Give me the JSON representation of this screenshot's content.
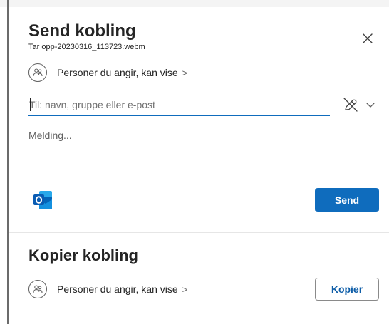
{
  "send_link": {
    "title": "Send kobling",
    "filename": "Tar opp-20230316_113723.webm",
    "permissions_label": "Personer du angir, kan vise",
    "permissions_chevron": ">",
    "to_placeholder": "Til: navn, gruppe eller e-post",
    "to_value": "",
    "message_placeholder": "Melding...",
    "send_label": "Send"
  },
  "copy_link": {
    "title": "Kopier kobling",
    "permissions_label": "Personer du angir, kan vise",
    "permissions_chevron": ">",
    "copy_label": "Kopier"
  },
  "icons": {
    "close": "close-icon",
    "people": "people-icon",
    "pen": "pen-slash-icon",
    "chevron_down": "chevron-down-icon",
    "outlook": "outlook-icon"
  },
  "colors": {
    "accent": "#0f6cbd",
    "copy_text": "#0f5ea8",
    "text": "#242424",
    "outlook_blue": "#0a64c2"
  }
}
